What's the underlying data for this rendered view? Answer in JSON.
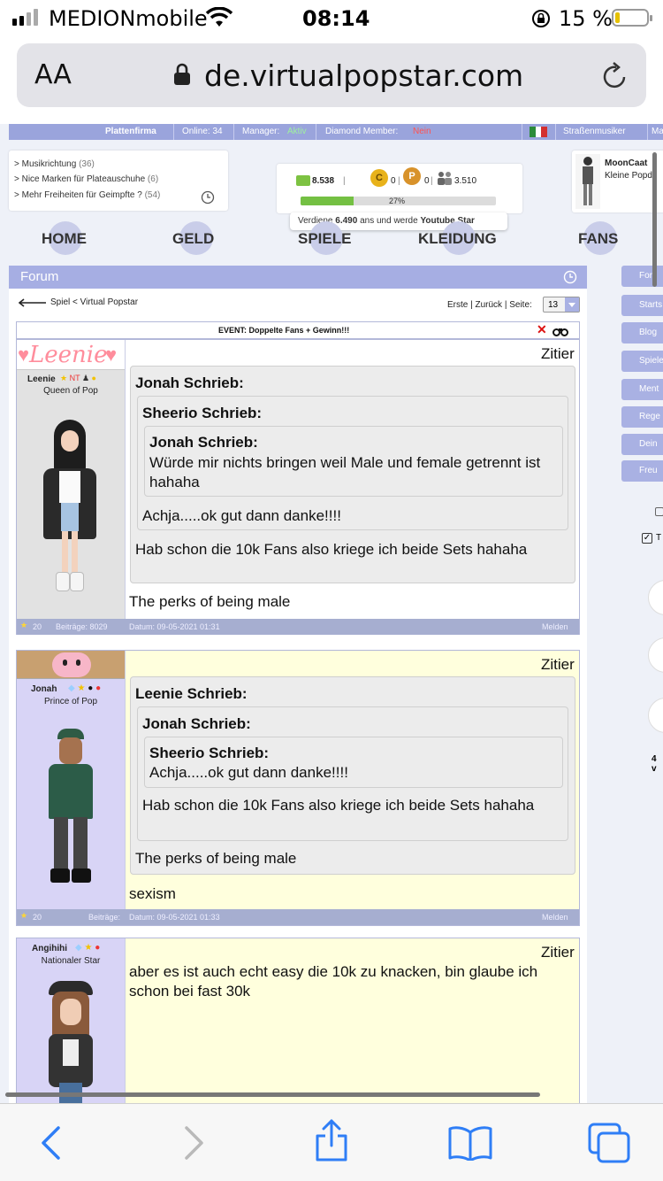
{
  "status_bar": {
    "carrier": "MEDIONmobile",
    "time": "08:14",
    "battery_percent": "15 %",
    "battery_level": 0.15
  },
  "browser": {
    "aa_label": "AA",
    "url": "de.virtualpopstar.com"
  },
  "top_nav": {
    "plattenfirma": "Plattenfirma",
    "online": "Online: 34",
    "manager_label": "Manager:",
    "manager_value": "Aktiv",
    "diamond_label": "Diamond Member:",
    "diamond_value": "Nein",
    "strassenmusiker": "Straßenmusiker",
    "cut_item": "Ma"
  },
  "news": [
    {
      "text": "> Musikrichtung",
      "count": "(36)"
    },
    {
      "text": "> Nice Marken für Plateauschuhe",
      "count": "(6)"
    },
    {
      "text": "> Mehr Freiheiten für Geimpfte ?",
      "count": "(54)"
    }
  ],
  "stats": {
    "money": "8.538",
    "coins": "0",
    "points": "0",
    "fans": "3.510",
    "progress_label": "27%",
    "progress": 0.27,
    "tooltip_prefix": "Verdiene",
    "tooltip_amount": "6.490",
    "tooltip_middle": "ans und werde",
    "tooltip_goal": "Youtube Star"
  },
  "profile": {
    "name": "MoonCaat",
    "title": "Kleine Popdo"
  },
  "main_nav": [
    "HOME",
    "GELD",
    "SPIELE",
    "KLEIDUNG",
    "FANS"
  ],
  "side_menu": [
    "Foru",
    "Starts",
    "Blog",
    "Spiele",
    "Ment",
    "Rege",
    "Dein",
    "Freu"
  ],
  "side_extra": {
    "checkbox_label": "T",
    "count": "4 v"
  },
  "forum": {
    "title": "Forum",
    "breadcrumb": "Spiel < Virtual Popstar",
    "pager": "Erste | Zurück | Seite:",
    "page": "13",
    "thread_title": "EVENT: Doppelte Fans + Gewinn!!!"
  },
  "posts": [
    {
      "avatar_banner": "Leenie",
      "username": "Leenie",
      "user_title": "Queen of Pop",
      "zitier": "Zitier",
      "q1_header": "Jonah Schrieb:",
      "q2_header": "Sheerio Schrieb:",
      "q3_header": "Jonah Schrieb:",
      "q3_text": "Würde mir nichts bringen weil Male und female getrennt ist hahaha",
      "q2_text": "Achja.....ok gut dann danke!!!!",
      "q1_text": "Hab schon die 10k Fans also kriege ich beide Sets hahaha",
      "body": "The perks of being male",
      "stars": "20",
      "posts_label": "Beiträge: 8029",
      "date": "Datum: 09-05-2021 01:31",
      "report": "Melden"
    },
    {
      "username": "Jonah",
      "user_title": "Prince of Pop",
      "zitier": "Zitier",
      "q1_header": "Leenie Schrieb:",
      "q2_header": "Jonah Schrieb:",
      "q3_header": "Sheerio Schrieb:",
      "q3_text": "Achja.....ok gut dann danke!!!!",
      "q2_text": "Hab schon die 10k Fans also kriege ich beide Sets hahaha",
      "q1_text": "The perks of being male",
      "body": "sexism",
      "stars": "20",
      "posts_label": "Beiträge:",
      "date": "Datum: 09-05-2021 01:33",
      "report": "Melden"
    },
    {
      "username": "Angihihi",
      "user_title": "Nationaler Star",
      "zitier": "Zitier",
      "body": "aber es ist auch echt easy die 10k zu knacken, bin glaube ich schon bei fast 30k"
    }
  ],
  "colors": {
    "nav": "#9aa4dc",
    "forum_header": "#a6aee3",
    "post_bg_alt": "#ffffdd",
    "user_panel": "#d8d4f6",
    "ios_blue": "#2f7ef6"
  },
  "toolbar_icons": [
    "back-icon",
    "forward-icon",
    "share-icon",
    "bookmarks-icon",
    "tabs-icon"
  ]
}
